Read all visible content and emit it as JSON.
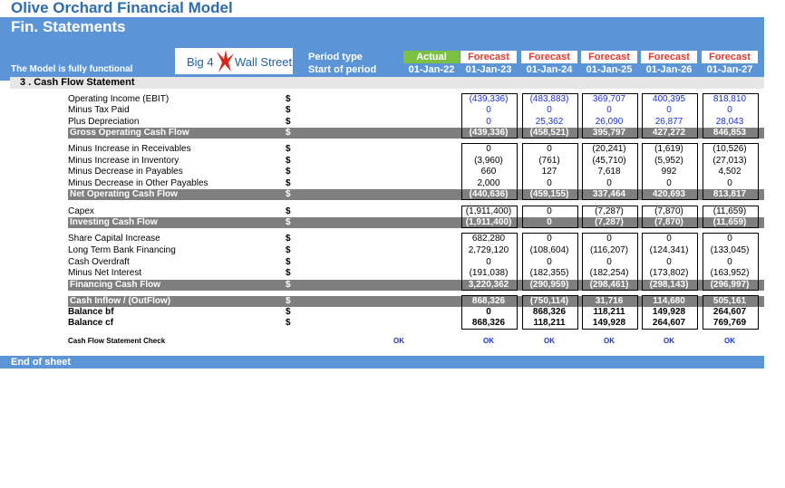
{
  "model_title": "Olive Orchard Financial Model",
  "sheet_title": "Fin. Statements",
  "status_text": "The Model is fully functional",
  "logo": {
    "left_text": "Big 4",
    "right_text": "Wall Street"
  },
  "period_type_label": "Period type",
  "start_label": "Start of period",
  "periods": [
    {
      "type": "Actual",
      "date": "01-Jan-22"
    },
    {
      "type": "Forecast",
      "date": "01-Jan-23"
    },
    {
      "type": "Forecast",
      "date": "01-Jan-24"
    },
    {
      "type": "Forecast",
      "date": "01-Jan-25"
    },
    {
      "type": "Forecast",
      "date": "01-Jan-26"
    },
    {
      "type": "Forecast",
      "date": "01-Jan-27"
    }
  ],
  "section_title": "3 . Cash Flow Statement",
  "currency": "$",
  "colors": {
    "header_blue": "#5b95d8",
    "actual_green": "#7cc043",
    "forecast_red": "#e6372b",
    "subtotal_grey": "#7f7f7f",
    "input_blue": "#1c2fe0"
  },
  "rows": {
    "ebit": {
      "label": "Operating Income (EBIT)",
      "values": [
        "(439,336)",
        "(483,883)",
        "369,707",
        "400,395",
        "818,810"
      ]
    },
    "tax": {
      "label": "Minus Tax Paid",
      "values": [
        "0",
        "0",
        "0",
        "0",
        "0"
      ]
    },
    "dep": {
      "label": "Plus Depreciation",
      "values": [
        "0",
        "25,362",
        "26,090",
        "26,877",
        "28,043"
      ]
    },
    "gross": {
      "label": "Gross Operating Cash Flow",
      "values": [
        "(439,336)",
        "(458,521)",
        "395,797",
        "427,272",
        "846,853"
      ]
    },
    "recv": {
      "label": "Minus Increase in Receivables",
      "values": [
        "0",
        "0",
        "(20,241)",
        "(1,619)",
        "(10,526)"
      ]
    },
    "inv": {
      "label": "Minus Increase in Inventory",
      "values": [
        "(3,960)",
        "(761)",
        "(45,710)",
        "(5,952)",
        "(27,013)"
      ]
    },
    "pay": {
      "label": "Minus Decrease in Payables",
      "values": [
        "660",
        "127",
        "7,618",
        "992",
        "4,502"
      ]
    },
    "opay": {
      "label": "Minus Decrease in Other Payables",
      "values": [
        "2,000",
        "0",
        "0",
        "0",
        "0"
      ]
    },
    "netop": {
      "label": "Net Operating Cash Flow",
      "values": [
        "(440,636)",
        "(459,155)",
        "337,464",
        "420,693",
        "813,817"
      ]
    },
    "capex": {
      "label": "Capex",
      "values": [
        "(1,911,400)",
        "0",
        "(7,287)",
        "(7,870)",
        "(11,659)"
      ]
    },
    "invest": {
      "label": "Investing Cash Flow",
      "values": [
        "(1,911,400)",
        "0",
        "(7,287)",
        "(7,870)",
        "(11,659)"
      ]
    },
    "share": {
      "label": "Share Capital Increase",
      "values": [
        "682,280",
        "0",
        "0",
        "0",
        "0"
      ]
    },
    "bank": {
      "label": "Long Term Bank Financing",
      "values": [
        "2,729,120",
        "(108,604)",
        "(116,207)",
        "(124,341)",
        "(133,045)"
      ]
    },
    "od": {
      "label": "Cash Overdraft",
      "values": [
        "0",
        "0",
        "0",
        "0",
        "0"
      ]
    },
    "int": {
      "label": "Minus Net Interest",
      "values": [
        "(191,038)",
        "(182,355)",
        "(182,254)",
        "(173,802)",
        "(163,952)"
      ]
    },
    "fin": {
      "label": "Financing Cash Flow",
      "values": [
        "3,220,362",
        "(290,959)",
        "(298,461)",
        "(298,143)",
        "(296,997)"
      ]
    },
    "inflow": {
      "label": "Cash Inflow / (OutFlow)",
      "values": [
        "868,326",
        "(750,114)",
        "31,716",
        "114,680",
        "505,161"
      ]
    },
    "bf": {
      "label": "Balance bf",
      "values": [
        "0",
        "868,326",
        "118,211",
        "149,928",
        "264,607"
      ]
    },
    "cf": {
      "label": "Balance cf",
      "values": [
        "868,326",
        "118,211",
        "149,928",
        "264,607",
        "769,769"
      ]
    }
  },
  "check": {
    "label": "Cash Flow Statement Check",
    "summary": "OK",
    "values": [
      "OK",
      "OK",
      "OK",
      "OK",
      "OK"
    ]
  },
  "end_text": "End of sheet"
}
